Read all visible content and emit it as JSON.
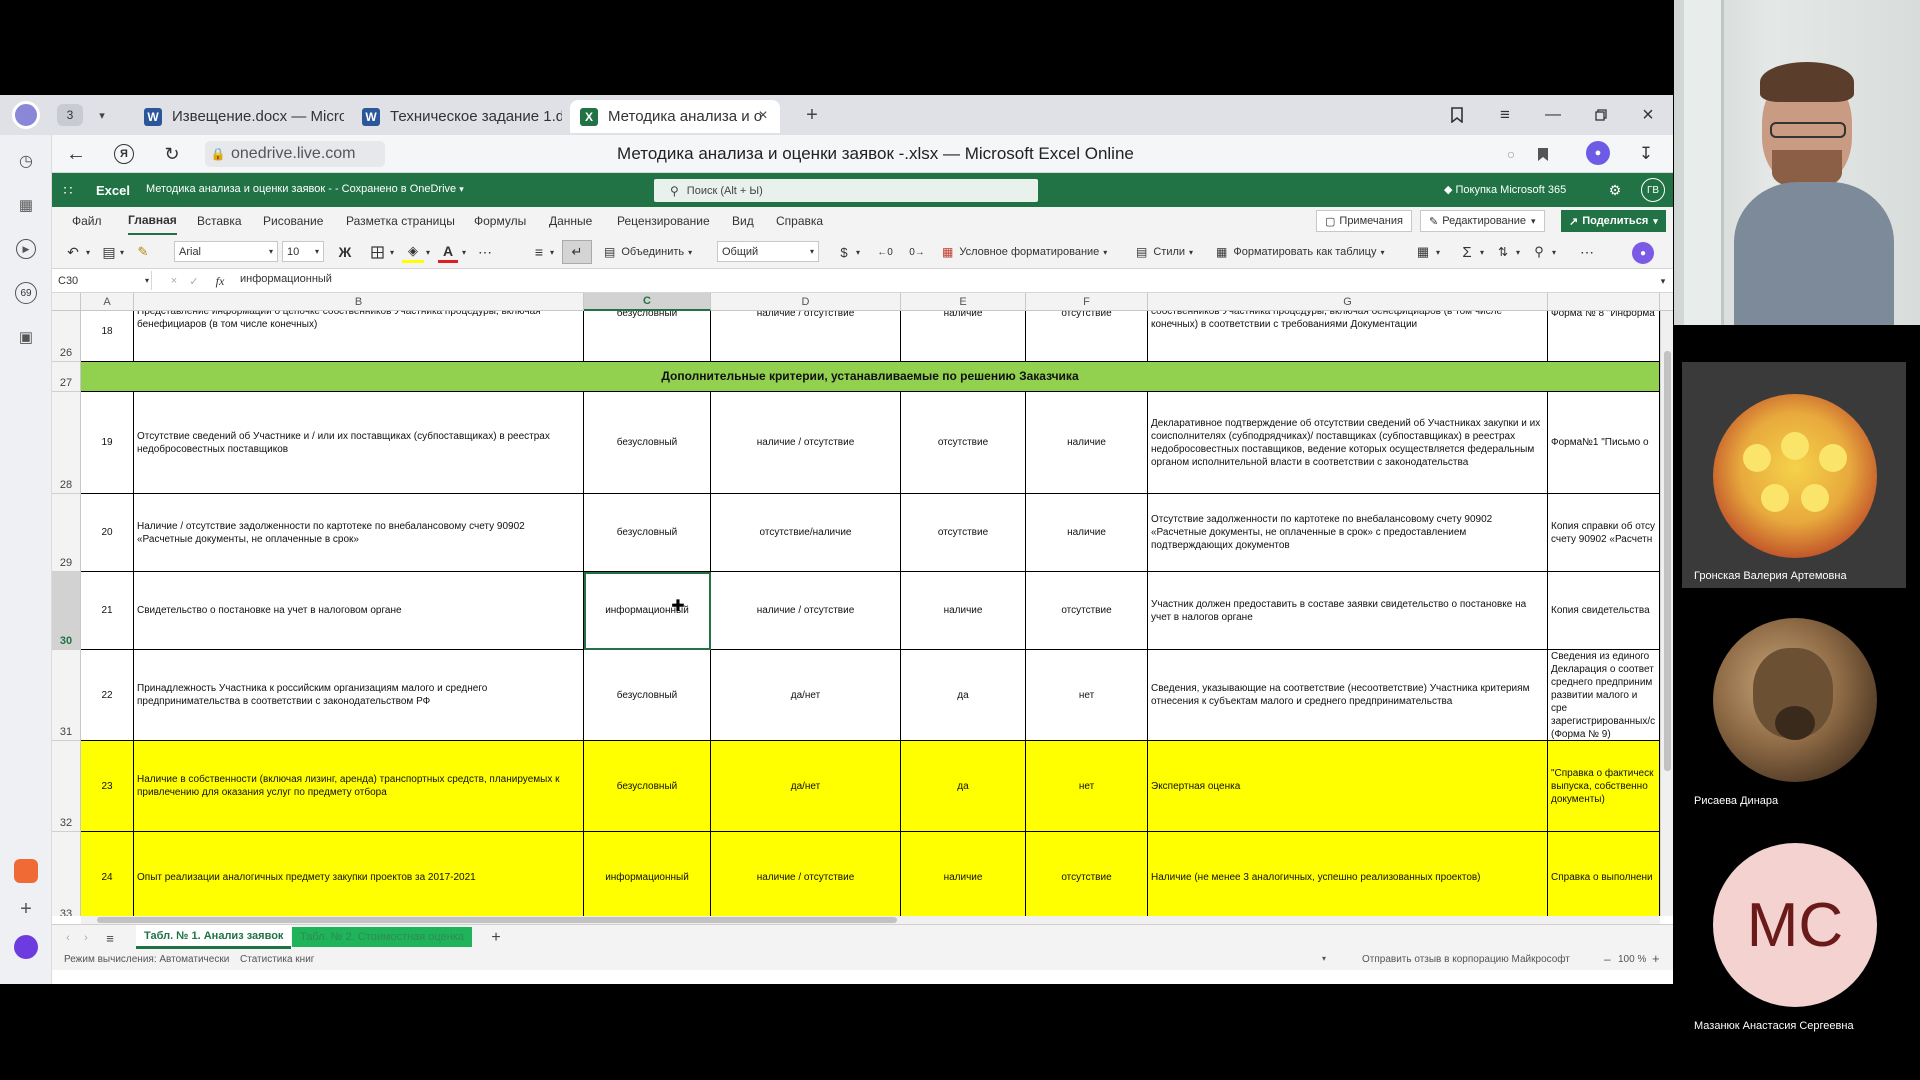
{
  "browser": {
    "tab_count": "3",
    "tabs": [
      {
        "label": "Извещение.docx — Micro",
        "icon": "W"
      },
      {
        "label": "Техническое задание 1.d",
        "icon": "W"
      },
      {
        "label": "Методика анализа и о",
        "icon": "X"
      }
    ],
    "url": "onedrive.live.com",
    "page_title": "Методика анализа и оценки заявок -.xlsx — Microsoft Excel Online",
    "rail_badge": "69"
  },
  "excel": {
    "app_name": "Excel",
    "doc_title": "Методика анализа и оценки заявок - - Сохранено в OneDrive",
    "search_placeholder": "Поиск (Alt + Ы)",
    "buy_label": "Покупка Microsoft 365",
    "user_initials": "ГВ",
    "menu": [
      "Файл",
      "Главная",
      "Вставка",
      "Рисование",
      "Разметка страницы",
      "Формулы",
      "Данные",
      "Рецензирование",
      "Вид",
      "Справка"
    ],
    "active_menu": "Главная",
    "comments_label": "Примечания",
    "editing_label": "Редактирование",
    "share_label": "Поделиться",
    "font_name": "Arial",
    "font_size": "10",
    "bold_label": "Ж",
    "merge_label": "Объединить",
    "number_format": "Общий",
    "currency_symbol": "$",
    "cond_format_label": "Условное форматирование",
    "styles_label": "Стили",
    "format_table_label": "Форматировать как таблицу",
    "name_box": "C30",
    "formula": "информационный",
    "fx_label": "fx",
    "columns": [
      "A",
      "B",
      "C",
      "D",
      "E",
      "F",
      "G"
    ]
  },
  "grid": {
    "rows": [
      {
        "num": "26",
        "a": "18",
        "b": "Представление информации о цепочке собственников Участника процедуры, включая бенефициаров (в том числе конечных)",
        "c": "безусловный",
        "d": "наличие / отсутствие",
        "e": "наличие",
        "f": "отсутствие",
        "g": "собственников Участника процедуры, включая бенефициаров (в том числе конечных) в соответствии с требованиями Документации",
        "h": "Форма № 8 \"Информа",
        "style": "normal"
      },
      {
        "num": "27",
        "title": "Дополнительные критерии, устанавливаемые по решению Заказчика",
        "style": "green"
      },
      {
        "num": "28",
        "a": "19",
        "b": "Отсутствие сведений об Участнике и / или их поставщиках (субпоставщиках) в реестрах недобросовестных поставщиков",
        "c": "безусловный",
        "d": "наличие / отсутствие",
        "e": "отсутствие",
        "f": "наличие",
        "g": "Декларативное подтверждение об отсутствии сведений об Участниках закупки и их соисполнителях (субподрядчиках)/ поставщиках (субпоставщиках) в реестрах недобросовестных поставщиков, ведение которых осуществляется федеральным органом исполнительной власти в соответствии с законодательства",
        "h": "Форма№1 \"Письмо о",
        "style": "normal"
      },
      {
        "num": "29",
        "a": "20",
        "b": "Наличие / отсутствие задолженности по картотеке по внебалансовому счету 90902 «Расчетные документы, не оплаченные в срок»",
        "c": "безусловный",
        "d": "отсутствие/наличие",
        "e": "отсутствие",
        "f": "наличие",
        "g": "Отсутствие задолженности по картотеке по внебалансовому счету 90902 «Расчетные документы, не оплаченные в срок» с предоставлением подтверждающих документов",
        "h": "Копия справки об отсу счету 90902 «Расчетн",
        "style": "normal"
      },
      {
        "num": "30",
        "a": "21",
        "b": "Свидетельство о постановке на учет в налоговом органе",
        "c": "информационный",
        "d": "наличие / отсутствие",
        "e": "наличие",
        "f": "отсутствие",
        "g": "Участник должен предоставить в составе заявки свидетельство о постановке на учет в налогов органе",
        "h": "Копия свидетельства",
        "style": "normal"
      },
      {
        "num": "31",
        "a": "22",
        "b": "Принадлежность Участника к российским организациям малого и среднего предпринимательства в соответствии с законодательством РФ",
        "c": "безусловный",
        "d": "да/нет",
        "e": "да",
        "f": "нет",
        "g": "Сведения, указывающие на соответствие (несоответствие) Участника критериям отнесения к субъектам малого и среднего предпринимательства",
        "h": "Сведения из единого Декларация о соответ среднего предприним развитии малого и сре зарегистрированных/с (Форма № 9)",
        "style": "normal"
      },
      {
        "num": "32",
        "a": "23",
        "b": "Наличие в собственности (включая лизинг, аренда) транспортных средств, планируемых к привлечению для оказания услуг по предмету отбора",
        "c": "безусловный",
        "d": "да/нет",
        "e": "да",
        "f": "нет",
        "g": "Экспертная оценка",
        "h": "\"Справка о фактическ выпуска, собственно документы)",
        "style": "yellow"
      },
      {
        "num": "33",
        "a": "24",
        "b": "Опыт реализации аналогичных предмету закупки проектов за 2017-2021",
        "c": "информационный",
        "d": "наличие / отсутствие",
        "e": "наличие",
        "f": "отсутствие",
        "g": "Наличие (не менее 3 аналогичных, успешно реализованных проектов)",
        "h": "Справка о выполнени",
        "style": "yellow"
      }
    ]
  },
  "sheets": {
    "active": "Табл. № 1. Анализ заявок",
    "other": "Табл. № 2. Стоимостная оценка"
  },
  "status": {
    "calc_mode": "Режим вычисления: Автоматически",
    "stats": "Статистика книг",
    "feedback": "Отправить отзыв в корпорацию Майкрософт",
    "zoom": "100 %"
  },
  "participants": [
    {
      "name": "Гронская Валерия Артемовна"
    },
    {
      "name": "Рисаева Динара"
    },
    {
      "name": "Мазанюк Анастасия Сергеевна",
      "initials": "МС"
    }
  ],
  "colors": {
    "excel_green": "#217346",
    "section_green": "#92d050",
    "highlight_yellow": "#ffff00",
    "ms_avatar": "#f3d2cf",
    "ms_initials": "#6b1a1a"
  }
}
